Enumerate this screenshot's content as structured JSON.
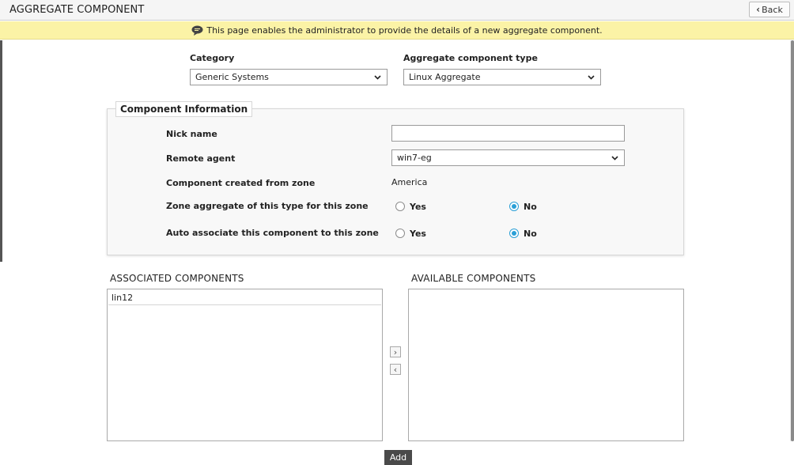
{
  "header": {
    "title": "AGGREGATE COMPONENT",
    "back_label": "Back",
    "back_icon": "chevron-left-icon"
  },
  "info_bar": {
    "icon": "speech-bubble-icon",
    "message": "This page enables the administrator to provide the details of a new aggregate component."
  },
  "form": {
    "category": {
      "label": "Category",
      "value": "Generic Systems"
    },
    "component_type": {
      "label": "Aggregate component type",
      "value": "Linux Aggregate"
    }
  },
  "component_info": {
    "legend": "Component Information",
    "nick_name": {
      "label": "Nick name",
      "value": ""
    },
    "remote_agent": {
      "label": "Remote agent",
      "value": "win7-eg"
    },
    "created_from_zone": {
      "label": "Component created from zone",
      "value": "America"
    },
    "zone_aggregate": {
      "label": "Zone aggregate of this type for this zone",
      "yes": "Yes",
      "no": "No",
      "selected": "No"
    },
    "auto_associate": {
      "label": "Auto associate this component to this zone",
      "yes": "Yes",
      "no": "No",
      "selected": "No"
    }
  },
  "associated": {
    "heading": "ASSOCIATED COMPONENTS",
    "items": [
      "lin12"
    ]
  },
  "available": {
    "heading": "AVAILABLE COMPONENTS",
    "items": []
  },
  "move_buttons": {
    "right": "›",
    "left": "‹"
  },
  "add_label": "Add",
  "colors": {
    "info_bar": "#fbf3a6",
    "radio_accent": "#2a9fd6",
    "add_button": "#4a4a4a"
  }
}
